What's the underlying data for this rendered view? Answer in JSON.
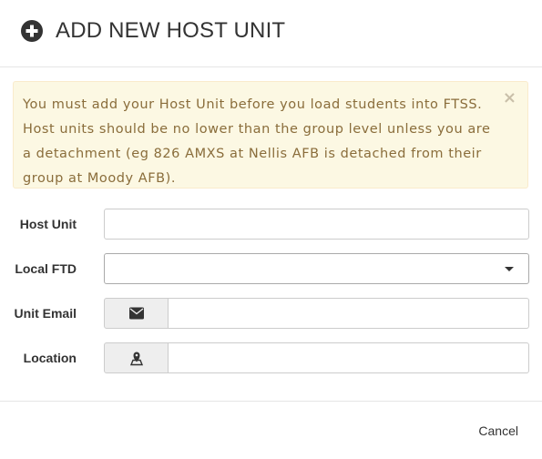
{
  "modal": {
    "title": "ADD NEW HOST UNIT",
    "title_icon": "plus-circle-icon"
  },
  "alert": {
    "message": "You must add your Host Unit before you load students into FTSS. Host units should be no lower than the group level unless you are a detachment (eg 826 AMXS at Nellis AFB is detached from their group at Moody AFB).",
    "close_symbol": "×",
    "background": "#fcf8e3",
    "text_color": "#8a6d3b"
  },
  "form": {
    "host_unit": {
      "label": "Host Unit",
      "value": ""
    },
    "local_ftd": {
      "label": "Local FTD",
      "selected": ""
    },
    "unit_email": {
      "label": "Unit Email",
      "value": "",
      "icon": "envelope-icon"
    },
    "location": {
      "label": "Location",
      "value": "",
      "icon": "map-marker-icon"
    }
  },
  "footer": {
    "cancel_label": "Cancel"
  }
}
